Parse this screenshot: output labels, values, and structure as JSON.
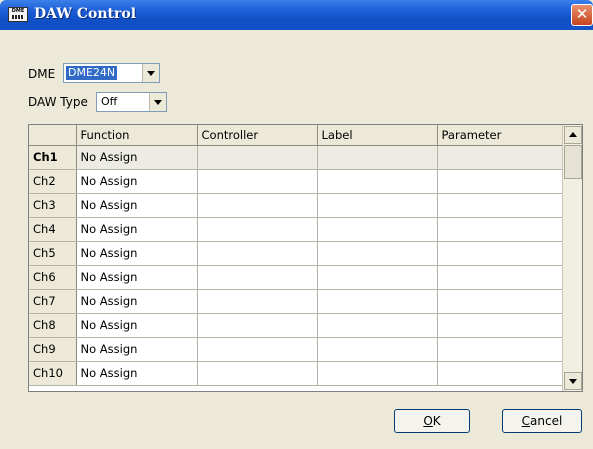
{
  "window": {
    "title": "DAW Control",
    "icon_text": "DME",
    "close_glyph": "✕"
  },
  "dme": {
    "label": "DME",
    "value": "DME24N"
  },
  "daw_type": {
    "label": "DAW Type",
    "value": "Off"
  },
  "table": {
    "columns": [
      "Function",
      "Controller",
      "Label",
      "Parameter"
    ],
    "rows": [
      {
        "ch": "Ch1",
        "function": "No Assign",
        "controller": "",
        "label": "",
        "parameter": ""
      },
      {
        "ch": "Ch2",
        "function": "No Assign",
        "controller": "",
        "label": "",
        "parameter": ""
      },
      {
        "ch": "Ch3",
        "function": "No Assign",
        "controller": "",
        "label": "",
        "parameter": ""
      },
      {
        "ch": "Ch4",
        "function": "No Assign",
        "controller": "",
        "label": "",
        "parameter": ""
      },
      {
        "ch": "Ch5",
        "function": "No Assign",
        "controller": "",
        "label": "",
        "parameter": ""
      },
      {
        "ch": "Ch6",
        "function": "No Assign",
        "controller": "",
        "label": "",
        "parameter": ""
      },
      {
        "ch": "Ch7",
        "function": "No Assign",
        "controller": "",
        "label": "",
        "parameter": ""
      },
      {
        "ch": "Ch8",
        "function": "No Assign",
        "controller": "",
        "label": "",
        "parameter": ""
      },
      {
        "ch": "Ch9",
        "function": "No Assign",
        "controller": "",
        "label": "",
        "parameter": ""
      },
      {
        "ch": "Ch10",
        "function": "No Assign",
        "controller": "",
        "label": "",
        "parameter": ""
      }
    ]
  },
  "buttons": {
    "ok_mnemonic": "O",
    "ok_rest": "K",
    "cancel_mnemonic": "C",
    "cancel_rest": "ancel"
  }
}
